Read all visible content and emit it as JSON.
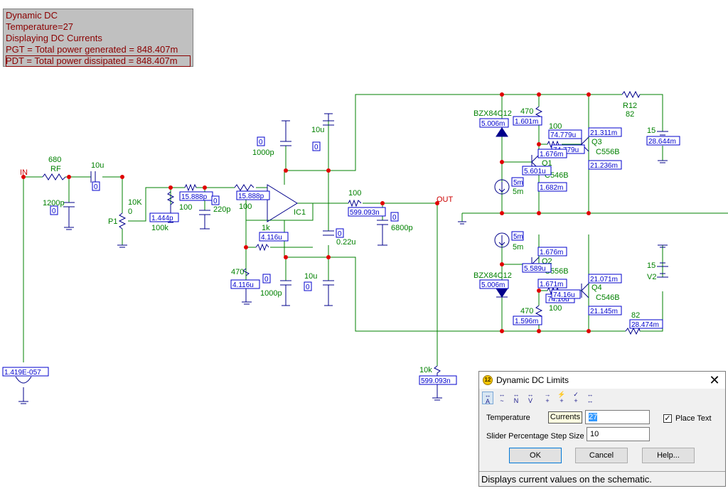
{
  "info_panel": {
    "lines": [
      "Dynamic DC",
      "Temperature=27",
      "Displaying DC Currents",
      "PGT = Total power generated = 848.407m",
      "PDT = Total power dissipated = 848.407m"
    ]
  },
  "schematic": {
    "net_labels": {
      "in": "IN",
      "out": "OUT"
    },
    "components": [
      {
        "id": "rf-name",
        "text": "RF"
      },
      {
        "id": "rf-value",
        "text": "680"
      },
      {
        "id": "c-in-value",
        "text": "10u"
      },
      {
        "id": "c-in-current",
        "text": "0"
      },
      {
        "id": "c-shunt-value",
        "text": "1200p"
      },
      {
        "id": "c-shunt-current",
        "text": "0"
      },
      {
        "id": "p1-name",
        "text": "P1"
      },
      {
        "id": "p1-value",
        "text": "10K"
      },
      {
        "id": "p1-pos",
        "text": "0"
      },
      {
        "id": "r-100-a",
        "text": "100"
      },
      {
        "id": "r-100-a-current",
        "text": "15.888p"
      },
      {
        "id": "r-100k",
        "text": "100k"
      },
      {
        "id": "r-100k-current",
        "text": "1.444p"
      },
      {
        "id": "c-220p",
        "text": "220p"
      },
      {
        "id": "c-220p-current",
        "text": "0"
      },
      {
        "id": "r-100-b",
        "text": "100"
      },
      {
        "id": "r-100-b-current",
        "text": "15.888p"
      },
      {
        "id": "ic1-name",
        "text": "IC1"
      },
      {
        "id": "r-1k",
        "text": "1k"
      },
      {
        "id": "r-1k-current",
        "text": "4.116u"
      },
      {
        "id": "r-470-in",
        "text": "470"
      },
      {
        "id": "r-470-in-current",
        "text": "4.116u"
      },
      {
        "id": "c-1000p-top",
        "text": "1000p"
      },
      {
        "id": "c-1000p-top-current",
        "text": "0"
      },
      {
        "id": "c-10u-top",
        "text": "10u"
      },
      {
        "id": "c-10u-top-current",
        "text": "0"
      },
      {
        "id": "c-022u",
        "text": "0.22u"
      },
      {
        "id": "c-022u-current",
        "text": "0"
      },
      {
        "id": "c-1000p-bot",
        "text": "1000p"
      },
      {
        "id": "c-1000p-bot-current",
        "text": "0"
      },
      {
        "id": "c-10u-bot",
        "text": "10u"
      },
      {
        "id": "c-10u-bot-current",
        "text": "0"
      },
      {
        "id": "r-out-100",
        "text": "100"
      },
      {
        "id": "r-out-100-current",
        "text": "599.093n"
      },
      {
        "id": "c-6800p",
        "text": "6800p"
      },
      {
        "id": "c-6800p-current",
        "text": "0"
      },
      {
        "id": "r-10k",
        "text": "10k"
      },
      {
        "id": "r-10k-current",
        "text": "599.093n"
      },
      {
        "id": "d-top-name",
        "text": "BZX84C12"
      },
      {
        "id": "d-top-current",
        "text": "5.006m"
      },
      {
        "id": "r-470-top",
        "text": "470"
      },
      {
        "id": "r-470-top-current",
        "text": "1.601m"
      },
      {
        "id": "r-100-q3",
        "text": "100"
      },
      {
        "id": "r-100-q3-current",
        "text": "74.779u"
      },
      {
        "id": "q3-ib",
        "text": "74.779u"
      },
      {
        "id": "q3-name",
        "text": "Q3"
      },
      {
        "id": "q3-model",
        "text": "C556B"
      },
      {
        "id": "q3-ie",
        "text": "21.311m"
      },
      {
        "id": "q3-ic",
        "text": "21.236m"
      },
      {
        "id": "q1-ib",
        "text": "1.676m"
      },
      {
        "id": "q1-ie",
        "text": "5.601u"
      },
      {
        "id": "q1-name",
        "text": "Q1"
      },
      {
        "id": "q1-model",
        "text": "C546B"
      },
      {
        "id": "q1-ic",
        "text": "1.682m"
      },
      {
        "id": "cs-top-current",
        "text": "5m"
      },
      {
        "id": "cs-top-value",
        "text": "5m"
      },
      {
        "id": "cs-bot-current",
        "text": "5m"
      },
      {
        "id": "cs-bot-value",
        "text": "5m"
      },
      {
        "id": "q2-ib",
        "text": "1.676m"
      },
      {
        "id": "q2-ie",
        "text": "5.589u"
      },
      {
        "id": "q2-name",
        "text": "Q2"
      },
      {
        "id": "q2-model",
        "text": "C556B"
      },
      {
        "id": "q2-ic",
        "text": "1.671m"
      },
      {
        "id": "d-bot-name",
        "text": "BZX84C12"
      },
      {
        "id": "d-bot-current",
        "text": "5.006m"
      },
      {
        "id": "r-100-q4",
        "text": "100"
      },
      {
        "id": "r-100-q4-current",
        "text": "74.16u"
      },
      {
        "id": "q4-ib",
        "text": "74.16u"
      },
      {
        "id": "q4-name",
        "text": "Q4"
      },
      {
        "id": "q4-model",
        "text": "C546B"
      },
      {
        "id": "q4-ie",
        "text": "21.071m"
      },
      {
        "id": "q4-ic",
        "text": "21.145m"
      },
      {
        "id": "r-470-bot",
        "text": "470"
      },
      {
        "id": "r-470-bot-current",
        "text": "1.596m"
      },
      {
        "id": "r12-name",
        "text": "R12"
      },
      {
        "id": "r12-value",
        "text": "82"
      },
      {
        "id": "v-top-value",
        "text": "15"
      },
      {
        "id": "v-top-current",
        "text": "28.644m"
      },
      {
        "id": "v2-value",
        "text": "15"
      },
      {
        "id": "v2-name",
        "text": "V2"
      },
      {
        "id": "r-82-bot",
        "text": "82"
      },
      {
        "id": "r-82-bot-current",
        "text": "28.474m"
      },
      {
        "id": "vin-current",
        "text": "1.419E-057"
      }
    ]
  },
  "dialog": {
    "title": "Dynamic DC Limits",
    "icon_glyph": "12",
    "close_glyph": "✕",
    "toolbar_icons": [
      "currents-mode-icon",
      "voltage-mode-icon",
      "node-voltage-icon",
      "voltage-drop-icon",
      "power-dissipation-icon",
      "power-generation-icon",
      "device-state-icon",
      "current-direction-icon"
    ],
    "tooltip": "Currents",
    "temperature_label": "Temperature",
    "temperature_value": "27",
    "place_text_label": "Place Text",
    "place_text_checked": true,
    "step_label": "Slider Percentage Step Size",
    "step_value": "10",
    "ok_label": "OK",
    "cancel_label": "Cancel",
    "help_label": "Help...",
    "status": "Displays current values on the schematic."
  },
  "colors": {
    "wire": "#008000",
    "component": "#00008b",
    "current_box": "#0000cd",
    "node": "#e00000",
    "label_green": "#008000",
    "net_label": "#cc0000",
    "info_text": "#8b0000"
  }
}
